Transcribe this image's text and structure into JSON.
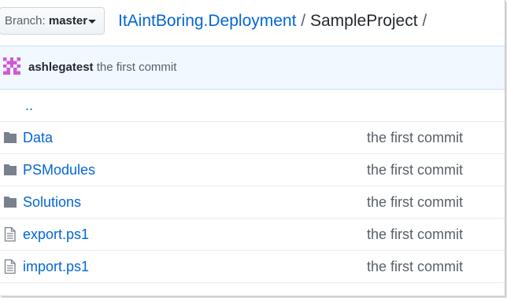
{
  "header": {
    "branch_prefix": "Branch:",
    "branch_name": "master",
    "repo_link": "ItAintBoring.Deployment",
    "separator_1": "/",
    "current_folder": "SampleProject",
    "separator_2": "/"
  },
  "commit_bar": {
    "author": "ashlegatest",
    "message": "the first commit"
  },
  "files": {
    "parent_link": "..",
    "items": [
      {
        "type": "folder",
        "name": "Data",
        "commit": "the first commit"
      },
      {
        "type": "folder",
        "name": "PSModules",
        "commit": "the first commit"
      },
      {
        "type": "folder",
        "name": "Solutions",
        "commit": "the first commit"
      },
      {
        "type": "file",
        "name": "export.ps1",
        "commit": "the first commit"
      },
      {
        "type": "file",
        "name": "import.ps1",
        "commit": "the first commit"
      }
    ]
  },
  "colors": {
    "link": "#0366d6",
    "commit_bar_bg": "#f1f8ff",
    "folder_icon": "#79818b",
    "avatar": "#d05ad6"
  },
  "icons": {
    "branch_caret": "caret-down-icon",
    "avatar": "identicon-avatar",
    "folder": "folder-icon",
    "file": "file-text-icon"
  }
}
